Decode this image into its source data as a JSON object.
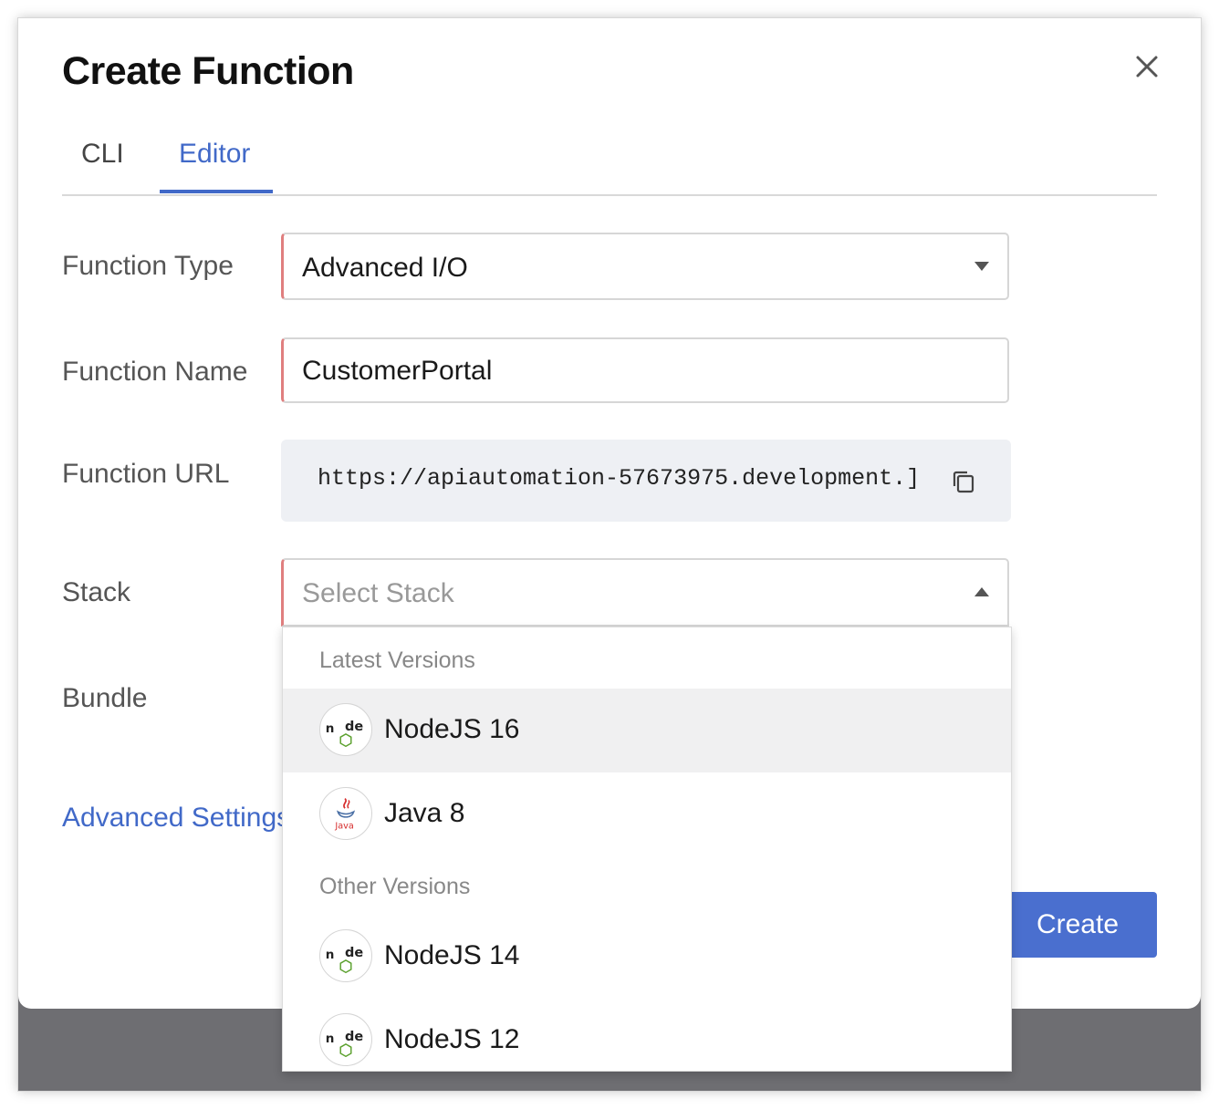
{
  "dialog": {
    "title": "Create Function",
    "tabs": [
      {
        "label": "CLI",
        "active": false
      },
      {
        "label": "Editor",
        "active": true
      }
    ]
  },
  "form": {
    "function_type": {
      "label": "Function Type",
      "value": "Advanced I/O"
    },
    "function_name": {
      "label": "Function Name",
      "value": "CustomerPortal"
    },
    "function_url": {
      "label": "Function URL",
      "value": "https://apiautomation-57673975.development.]"
    },
    "stack": {
      "label": "Stack",
      "placeholder": "Select Stack"
    },
    "bundle": {
      "label": "Bundle"
    },
    "advanced_settings": "Advanced Settings"
  },
  "stack_dropdown": {
    "groups": [
      {
        "label": "Latest Versions",
        "options": [
          {
            "label": "NodeJS 16",
            "icon": "nodejs-icon",
            "highlighted": true
          },
          {
            "label": "Java 8",
            "icon": "java-icon",
            "highlighted": false
          }
        ]
      },
      {
        "label": "Other Versions",
        "options": [
          {
            "label": "NodeJS 14",
            "icon": "nodejs-icon",
            "highlighted": false
          },
          {
            "label": "NodeJS 12",
            "icon": "nodejs-icon",
            "highlighted": false
          }
        ]
      }
    ]
  },
  "actions": {
    "create_label": "Create"
  },
  "colors": {
    "accent": "#4169c8",
    "button": "#4a6fcf",
    "required_marker": "#e07f7f",
    "overlay": "#6e6e72"
  }
}
